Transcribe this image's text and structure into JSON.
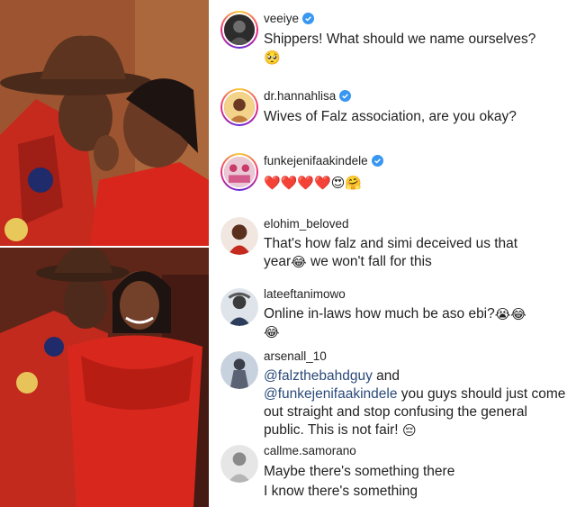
{
  "comments": [
    {
      "username": "veeiye",
      "verified": true,
      "text": "Shippers! What should we name ourselves?",
      "emoji": "🥺"
    },
    {
      "username": "dr.hannahlisa",
      "verified": true,
      "text": "Wives of Falz association, are you okay?"
    },
    {
      "username": "funkejenifaakindele",
      "verified": true,
      "emoji": "❤️❤️❤️❤️😍🤗"
    },
    {
      "username": "elohim_beloved",
      "verified": false,
      "text_line1": "That's how falz and simi deceived us that",
      "text_line2a": "year",
      "emoji_mid": "😂",
      "text_line2b": " we won't fall for this"
    },
    {
      "username": "lateeftanimowo",
      "verified": false,
      "text": "Online in-laws how much be aso ebi?",
      "emoji": "😭😂",
      "emoji_line2": "😂"
    },
    {
      "username": "arsenall_10",
      "verified": false,
      "mention1": "@falzthebahdguy",
      "text_and": " and",
      "mention2": "@funkejenifaakindele",
      "text_rest": " you guys should just come out straight and stop confusing the general public. This is not fair!",
      "emoji": "😔"
    },
    {
      "username": "callme.samorano",
      "verified": false,
      "text_line1": "Maybe there's something there",
      "text_line2": "I know there's something"
    }
  ],
  "colors": {
    "verified_blue": "#3897f0",
    "mention": "#2b4a7a"
  }
}
